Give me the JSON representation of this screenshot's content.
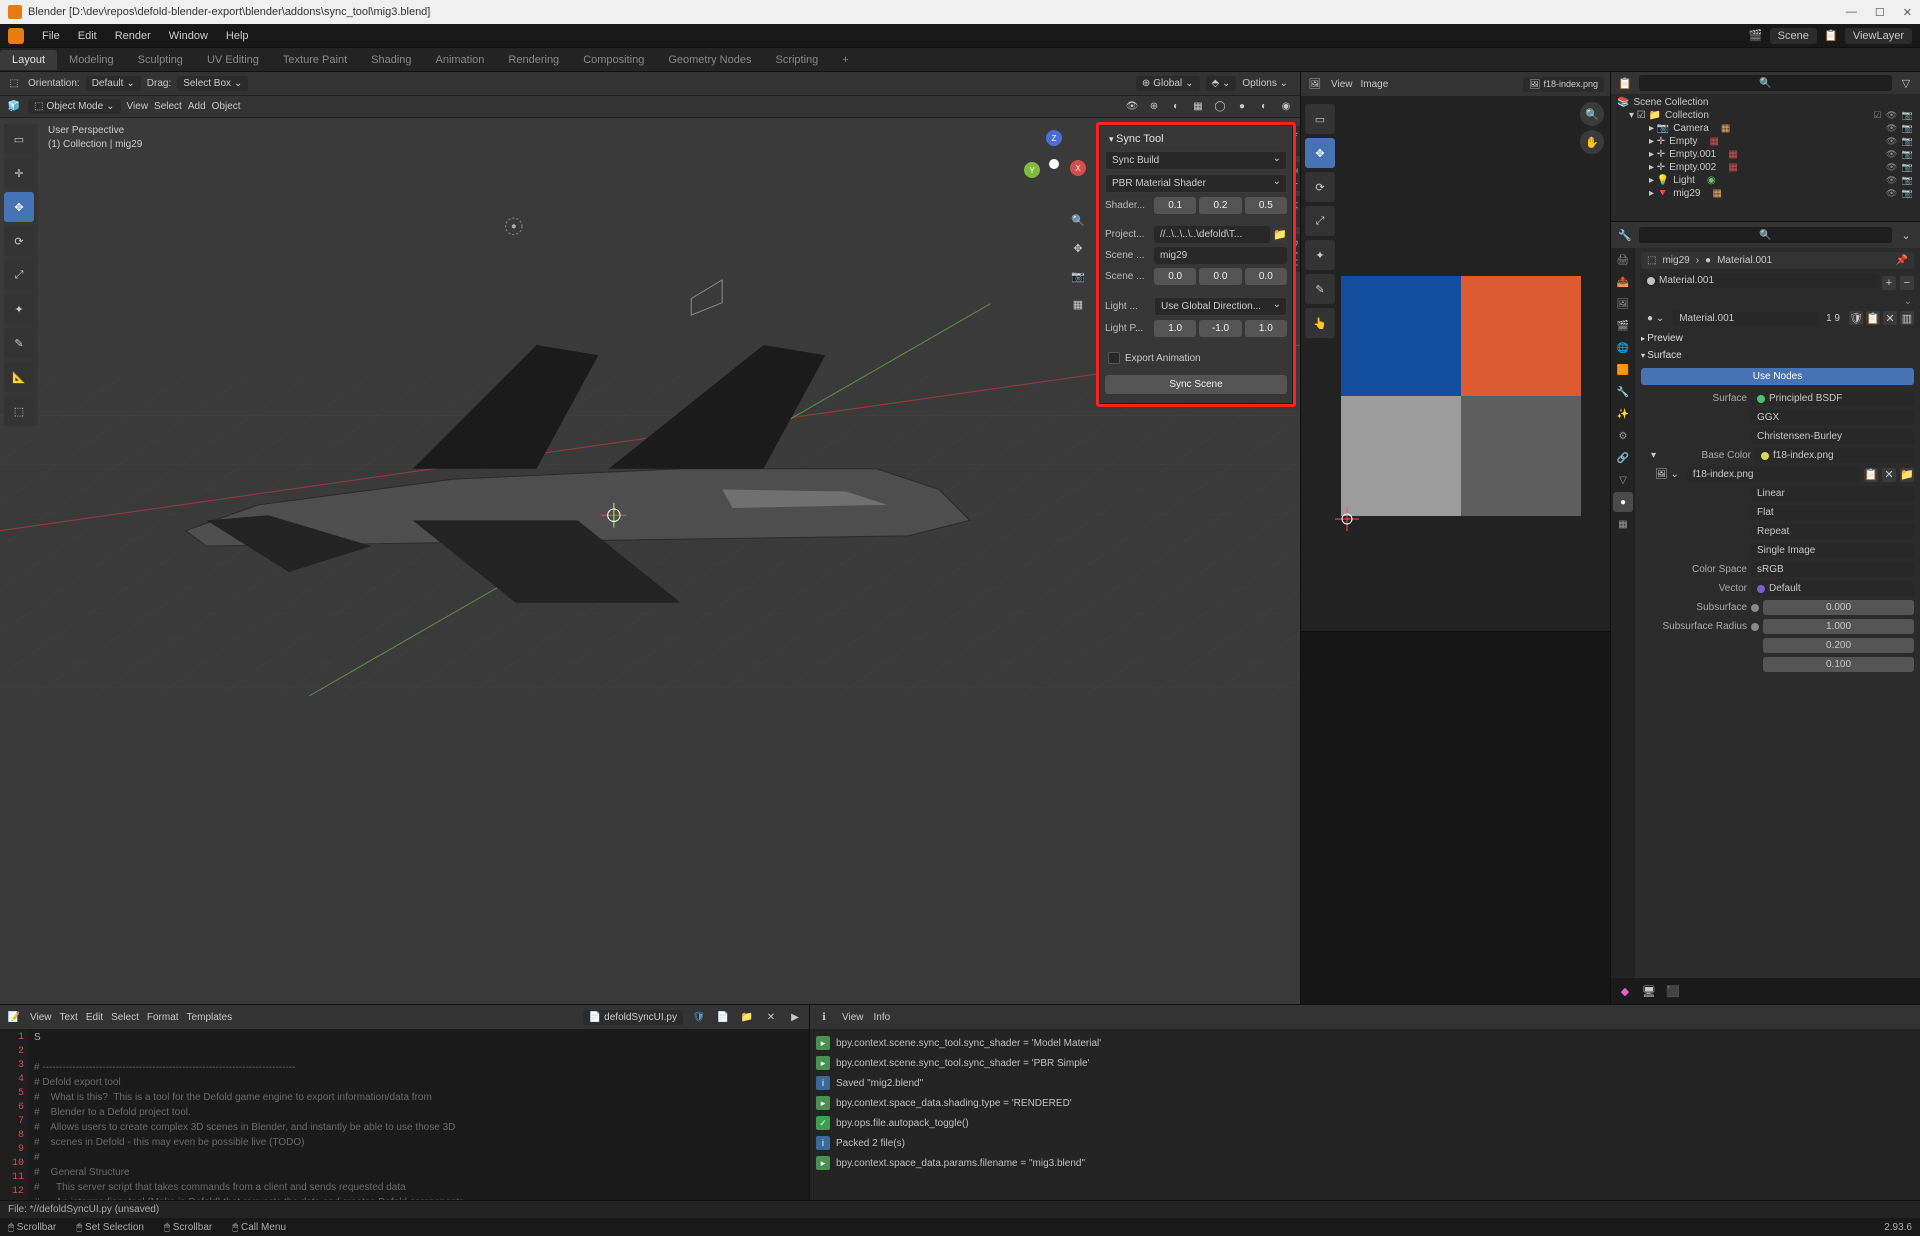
{
  "title": "Blender [D:\\dev\\repos\\defold-blender-export\\blender\\addons\\sync_tool\\mig3.blend]",
  "topmenu": [
    "File",
    "Edit",
    "Render",
    "Window",
    "Help"
  ],
  "workspaces": [
    "Layout",
    "Modeling",
    "Sculpting",
    "UV Editing",
    "Texture Paint",
    "Shading",
    "Animation",
    "Rendering",
    "Compositing",
    "Geometry Nodes",
    "Scripting"
  ],
  "active_ws": "Layout",
  "scene_name": "Scene",
  "view_layer": "ViewLayer",
  "vp_header": {
    "mode": "Object Mode",
    "view": "View",
    "select": "Select",
    "add": "Add",
    "object": "Object",
    "global": "Global",
    "options": "Options",
    "orientation": "Orientation:",
    "default": "Default",
    "drag": "Drag:",
    "selectbox": "Select Box"
  },
  "persp": {
    "l1": "User Perspective",
    "l2": "(1) Collection | mig29"
  },
  "sync": {
    "title": "Sync Tool",
    "build": "Sync Build",
    "shader": "PBR Material Shader",
    "shader_lbl": "Shader...",
    "sv": [
      "0.1",
      "0.2",
      "0.5"
    ],
    "project_lbl": "Project...",
    "project_val": "//..\\..\\..\\..\\defold\\T...",
    "scene_lbl": "Scene ...",
    "scene_name": "mig29",
    "scene_lbl2": "Scene ...",
    "sv2": [
      "0.0",
      "0.0",
      "0.0"
    ],
    "light_lbl": "Light ...",
    "light_mode": "Use Global Direction...",
    "lightp_lbl": "Light P...",
    "lv": [
      "1.0",
      "-1.0",
      "1.0"
    ],
    "export_anim": "Export Animation",
    "syncscene": "Sync Scene"
  },
  "sidetabs": [
    "Item",
    "Tool",
    "View",
    "Defold"
  ],
  "uv": {
    "view": "View",
    "image": "Image",
    "file": "f18-index.png"
  },
  "outliner": {
    "root": "Scene Collection",
    "col": "Collection",
    "items": [
      "Camera",
      "Empty",
      "Empty.001",
      "Empty.002",
      "Light",
      "mig29"
    ]
  },
  "props": {
    "search_hdr": "",
    "breadcrumb_obj": "mig29",
    "breadcrumb_mat": "Material.001",
    "matname": "Material.001",
    "users": "1 9",
    "preview_lbl": "Preview",
    "surface_lbl": "Surface",
    "use_nodes": "Use Nodes",
    "surface_k": "Surface",
    "surface_v": "Principled BSDF",
    "dist": "GGX",
    "sss": "Christensen-Burley",
    "base_k": "Base Color",
    "base_v": "f18-index.png",
    "tex_v": "f18-index.png",
    "interp": "Linear",
    "proj": "Flat",
    "repeat": "Repeat",
    "single": "Single Image",
    "cspace_k": "Color Space",
    "cspace_v": "sRGB",
    "vector_k": "Vector",
    "vector_v": "Default",
    "subsurf_k": "Subsurface",
    "subsurf_v": "0.000",
    "ssr_k": "Subsurface Radius",
    "ssr_v": [
      "1.000",
      "0.200",
      "0.100"
    ]
  },
  "ted": {
    "menus": [
      "View",
      "Text",
      "Edit",
      "Select",
      "Format",
      "Templates"
    ],
    "file": "defoldSyncUI.py",
    "lines": [
      "S",
      "",
      "# ----------------------------------------------------------------------------",
      "# Defold export tool",
      "#    What is this?  This is a tool for the Defold game engine to export information/data from",
      "#    Blender to a Defold project tool.",
      "#    Allows users to create complex 3D scenes in Blender, and instantly be able to use those 3D",
      "#    scenes in Defold - this may even be possible live (TODO)",
      "#",
      "#    General Structure",
      "#      This server script that takes commands from a client and sends requested data",
      "#      An intermediary tool (Make in Defold) that requests the data and creates Defold components",
      "#      The Defold project is assigned to the intermediary tool which allows direct export to the project"
    ]
  },
  "info": {
    "view": "View",
    "info": "Info",
    "lines": [
      {
        "t": "op",
        "s": "bpy.context.scene.sync_tool.sync_shader = 'Model Material'"
      },
      {
        "t": "op",
        "s": "bpy.context.scene.sync_tool.sync_shader = 'PBR Simple'"
      },
      {
        "t": "inf",
        "s": "Saved \"mig2.blend\""
      },
      {
        "t": "op",
        "s": "bpy.context.space_data.shading.type = 'RENDERED'"
      },
      {
        "t": "chk",
        "s": "bpy.ops.file.autopack_toggle()"
      },
      {
        "t": "inf",
        "s": "Packed 2 file(s)"
      },
      {
        "t": "op",
        "s": "bpy.context.space_data.params.filename = \"mig3.blend\""
      }
    ]
  },
  "status1": "File: *//defoldSyncUI.py (unsaved)",
  "status2": {
    "a": "Scrollbar",
    "b": "Set Selection",
    "c": "Scrollbar",
    "d": "Call Menu",
    "ver": "2.93.6"
  }
}
